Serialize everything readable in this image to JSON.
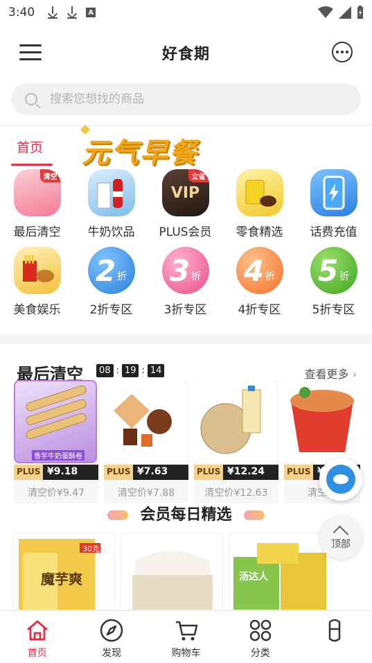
{
  "status_bar": {
    "time": "3:40",
    "a_icon_letter": "A"
  },
  "header": {
    "title": "好食期"
  },
  "search": {
    "placeholder": "搜索您想找的商品"
  },
  "top_tabs": {
    "active": "首页",
    "banner_text": "元气早餐"
  },
  "categories": [
    {
      "label": "最后清空",
      "badge": "清空",
      "icon": "clearance-icon",
      "color": "#f6a3b2"
    },
    {
      "label": "牛奶饮品",
      "icon": "milk-drink-icon",
      "color": "#8ec8f1"
    },
    {
      "label": "PLUS会员",
      "badge": "立省",
      "icon_text": "VIP",
      "icon": "vip-icon",
      "color": "#3b2a22"
    },
    {
      "label": "零食精选",
      "icon": "snack-icon",
      "color": "#f2d34a"
    },
    {
      "label": "话费充值",
      "icon": "phone-topup-icon",
      "color": "#3a8fe6"
    },
    {
      "label": "美食娱乐",
      "icon": "food-fun-icon",
      "color": "#f4c23b"
    },
    {
      "label": "2折专区",
      "num": "2",
      "unit": "折",
      "icon": "discount-2-icon",
      "color": "#3a93e8"
    },
    {
      "label": "3折专区",
      "num": "3",
      "unit": "折",
      "icon": "discount-3-icon",
      "color": "#f06fa0"
    },
    {
      "label": "4折专区",
      "num": "4",
      "unit": "折",
      "icon": "discount-4-icon",
      "color": "#f58a3a"
    },
    {
      "label": "5折专区",
      "num": "5",
      "unit": "折",
      "icon": "discount-5-icon",
      "color": "#5dbb3a"
    }
  ],
  "flash_sale": {
    "title": "最后清空",
    "countdown": [
      "08",
      "19",
      "14"
    ],
    "more_label": "查看更多",
    "products": [
      {
        "plus_label": "PLUS",
        "price": "¥9.18",
        "original": "清空价¥9.47",
        "color": "#c9a5e8",
        "caption": "香芋牛奶蛋酥卷"
      },
      {
        "plus_label": "PLUS",
        "price": "¥7.63",
        "original": "清空价¥7.88",
        "color": "#e9a76a"
      },
      {
        "plus_label": "PLUS",
        "price": "¥12.24",
        "original": "清空价¥12.63",
        "color": "#d8c49a"
      },
      {
        "plus_label": "PLUS",
        "price": "¥10.6",
        "original": "清空价",
        "color": "#e8483c"
      }
    ]
  },
  "daily_pick": {
    "title": "会员每日精选",
    "cards": [
      {
        "text": "魔芋爽",
        "tag": "30克",
        "color": "#f4d05a"
      },
      {
        "text": "",
        "color": "#f2ede4"
      },
      {
        "text": "汤达人",
        "color": "#7fc34a"
      }
    ]
  },
  "floating": {
    "top_label": "顶部"
  },
  "tab_bar": [
    {
      "label": "首页",
      "active": true,
      "icon": "home-icon"
    },
    {
      "label": "发现",
      "active": false,
      "icon": "compass-icon"
    },
    {
      "label": "购物车",
      "active": false,
      "icon": "cart-icon"
    },
    {
      "label": "分类",
      "active": false,
      "icon": "grid-icon"
    },
    {
      "label": "",
      "active": false,
      "icon": "profile-icon"
    }
  ],
  "accent": "#e0334f"
}
